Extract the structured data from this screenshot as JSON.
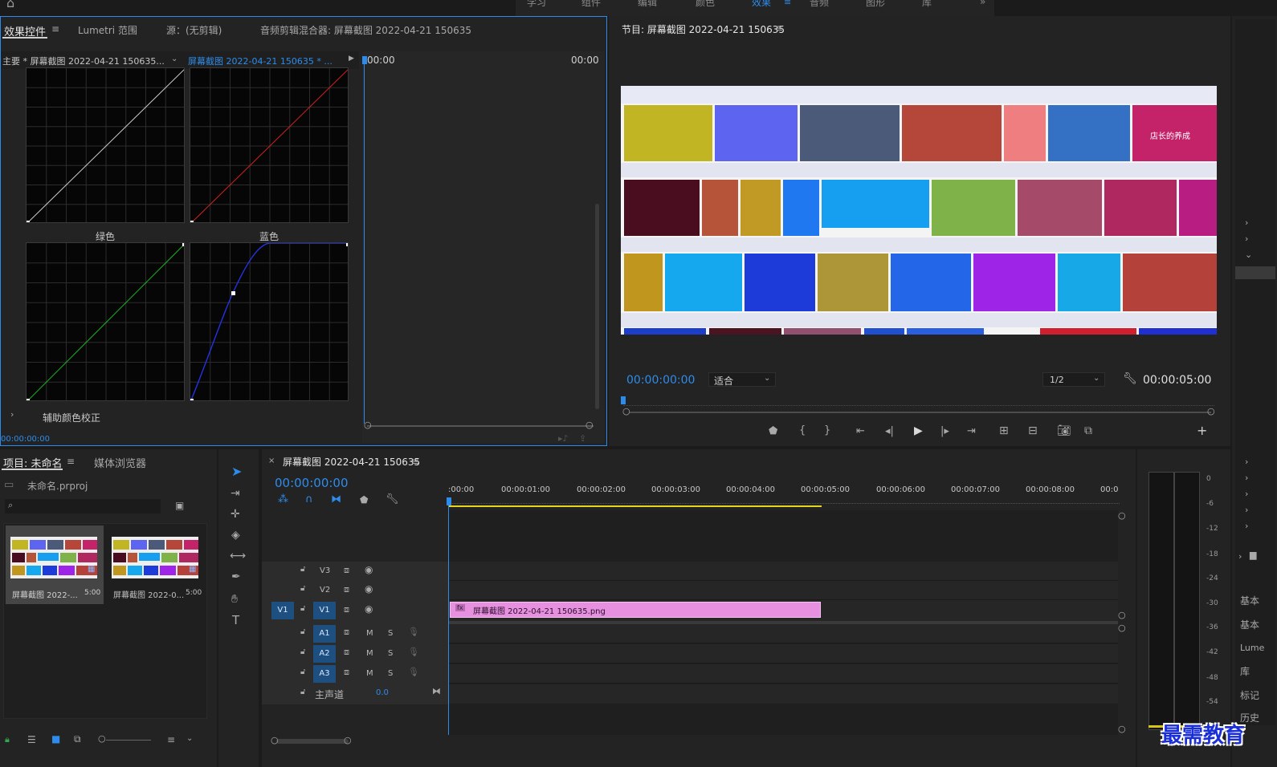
{
  "top_menu": {
    "items": [
      "学习",
      "组件",
      "编辑",
      "颜色",
      "效果",
      "音频",
      "图形",
      "库"
    ],
    "active_index": 4
  },
  "effects_panel": {
    "tabs": [
      "效果控件",
      "Lumetri 范围",
      "源：(无剪辑)",
      "音频剪辑混合器: 屏幕截图 2022-04-21 150635"
    ],
    "master_clip": "主要 * 屏幕截图 2022-04-21 150635...",
    "sequence_clip": "屏幕截图 2022-04-21 150635 * ...",
    "time_start": "00:00",
    "time_end": "00:00",
    "curve_labels": {
      "green": "绿色",
      "blue": "蓝色"
    },
    "secondary_correction": "辅助颜色校正",
    "timecode": "00:00:00:00"
  },
  "program_monitor": {
    "title": "节目: 屏幕截图 2022-04-21 150635",
    "timecode": "00:00:00:00",
    "fit_label": "适合",
    "resolution": "1/2",
    "duration": "00:00:05:00",
    "caption_text": "店长的养成"
  },
  "project_panel": {
    "tabs": [
      "项目: 未命名",
      "媒体浏览器"
    ],
    "project_file": "未命名.prproj",
    "search_placeholder": "",
    "items": [
      {
        "name": "屏幕截图 2022-...",
        "duration": "5:00"
      },
      {
        "name": "屏幕截图 2022-0...",
        "duration": "5:00"
      }
    ]
  },
  "timeline": {
    "title": "屏幕截图 2022-04-21 150635",
    "timecode": "00:00:00:00",
    "ruler": [
      ":00:00",
      "00:00:01:00",
      "00:00:02:00",
      "00:00:03:00",
      "00:00:04:00",
      "00:00:05:00",
      "00:00:06:00",
      "00:00:07:00",
      "00:00:08:00",
      "00:0"
    ],
    "video_tracks": [
      "V3",
      "V2",
      "V1"
    ],
    "audio_tracks": [
      "A1",
      "A2",
      "A3"
    ],
    "source_patch": "V1",
    "master_label": "主声道",
    "master_value": "0.0",
    "mute_label": "M",
    "solo_label": "S",
    "clip_name": "屏幕截图 2022-04-21 150635.png",
    "clip_badge": "fx"
  },
  "audio_meter": {
    "ticks": [
      "0",
      "-6",
      "-12",
      "-18",
      "-24",
      "-30",
      "-36",
      "-42",
      "-48",
      "-54"
    ]
  },
  "right_sidebar": {
    "labels": [
      "基本",
      "基本",
      "Lume",
      "库",
      "标记",
      "历史"
    ]
  },
  "watermark": "最需教育",
  "colors": {
    "accent_blue": "#2d8ceb",
    "clip_pink": "#e890e0",
    "track_blue": "#1d4f80",
    "panel_bg": "#232323",
    "curve_white": "#cfcfcf",
    "curve_red": "#d42020",
    "curve_green": "#21b021",
    "curve_blue": "#2432e0"
  }
}
